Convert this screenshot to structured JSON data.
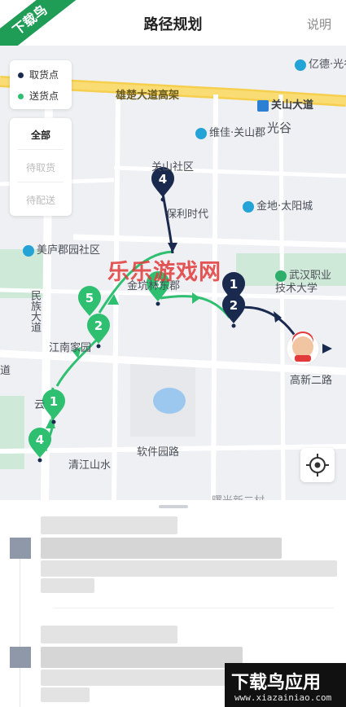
{
  "header": {
    "title": "路径规划",
    "explain_label": "说明",
    "ribbon_text": "下载鸟"
  },
  "legend": [
    {
      "label": "取货点",
      "color": "#1a2a4f"
    },
    {
      "label": "送货点",
      "color": "#2fbf71"
    }
  ],
  "filter": [
    "全部",
    "待取货",
    "待配送"
  ],
  "map": {
    "places": {
      "yiqi": "亿德·光谷",
      "road_elevated": "雄楚大道高架",
      "guanshan_ave": "关山大道",
      "guanggu": "光谷",
      "weijia": "维佳·关山郡",
      "guanshan_community": "关山社区",
      "baoli": "保利时代",
      "jindi": "金地·太阳城",
      "meilu": "美庐郡园社区",
      "jinkeng": "金坑林东郡",
      "wuhan_college": "武汉职业技术大学",
      "minzu_ave": "民族大道",
      "jiangnan": "江南家园",
      "dao": "道",
      "yun": "云",
      "gaoxin2": "高新二路",
      "software_park": "软件园路",
      "qingjiang": "清江山水",
      "bottom_poi": "曙光新二村"
    },
    "markers": [
      {
        "num": "4",
        "type": "pickup"
      },
      {
        "num": "1",
        "type": "pickup"
      },
      {
        "num": "2",
        "type": "pickup"
      },
      {
        "num": "3",
        "type": "delivery"
      },
      {
        "num": "5",
        "type": "delivery"
      },
      {
        "num": "2",
        "type": "delivery"
      },
      {
        "num": "1",
        "type": "delivery"
      },
      {
        "num": "4",
        "type": "delivery"
      }
    ],
    "watermark": "乐乐游戏网",
    "colors": {
      "pickup": "#1a2a4f",
      "delivery": "#2fbf71"
    }
  },
  "brand": {
    "title": "下载鸟应用",
    "url": "www.xiazainiao.com"
  }
}
